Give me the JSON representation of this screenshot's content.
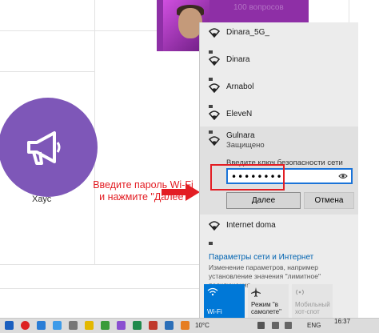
{
  "background_page": {
    "promo_text": "100 вопросов",
    "house_label": "Хаус"
  },
  "annotation": {
    "line1": "Введите пароль Wi-Fi",
    "line2": "и нажмите \"Далее\"",
    "color": "#e31e24"
  },
  "wifi_panel": {
    "networks_top": [
      {
        "name": "Dinara_5G_"
      },
      {
        "name": "Dinara"
      },
      {
        "name": "Arnabol"
      },
      {
        "name": "EleveN"
      }
    ],
    "selected_network": {
      "name": "Gulnara",
      "status": "Защищено",
      "password_label": "Введите ключ безопасности сети",
      "password_value": "••••••••",
      "next_button": "Далее",
      "cancel_button": "Отмена"
    },
    "networks_bottom": [
      {
        "name": "Internet doma"
      }
    ],
    "settings_link": "Параметры сети и Интернет",
    "settings_description": "Изменение параметров, например установление значения \"лимитное\" подключения.",
    "tiles": [
      {
        "label": "Wi-Fi",
        "icon": "wifi-icon",
        "active": true
      },
      {
        "label": "Режим \"в самолете\"",
        "icon": "airplane-icon",
        "active": false
      },
      {
        "label": "Мобильный хот-спот",
        "icon": "hotspot-icon",
        "active": false
      }
    ],
    "accent": "#0078d7"
  },
  "taskbar": {
    "temperature": "10°C",
    "language": "ENG",
    "time": "16:37"
  }
}
